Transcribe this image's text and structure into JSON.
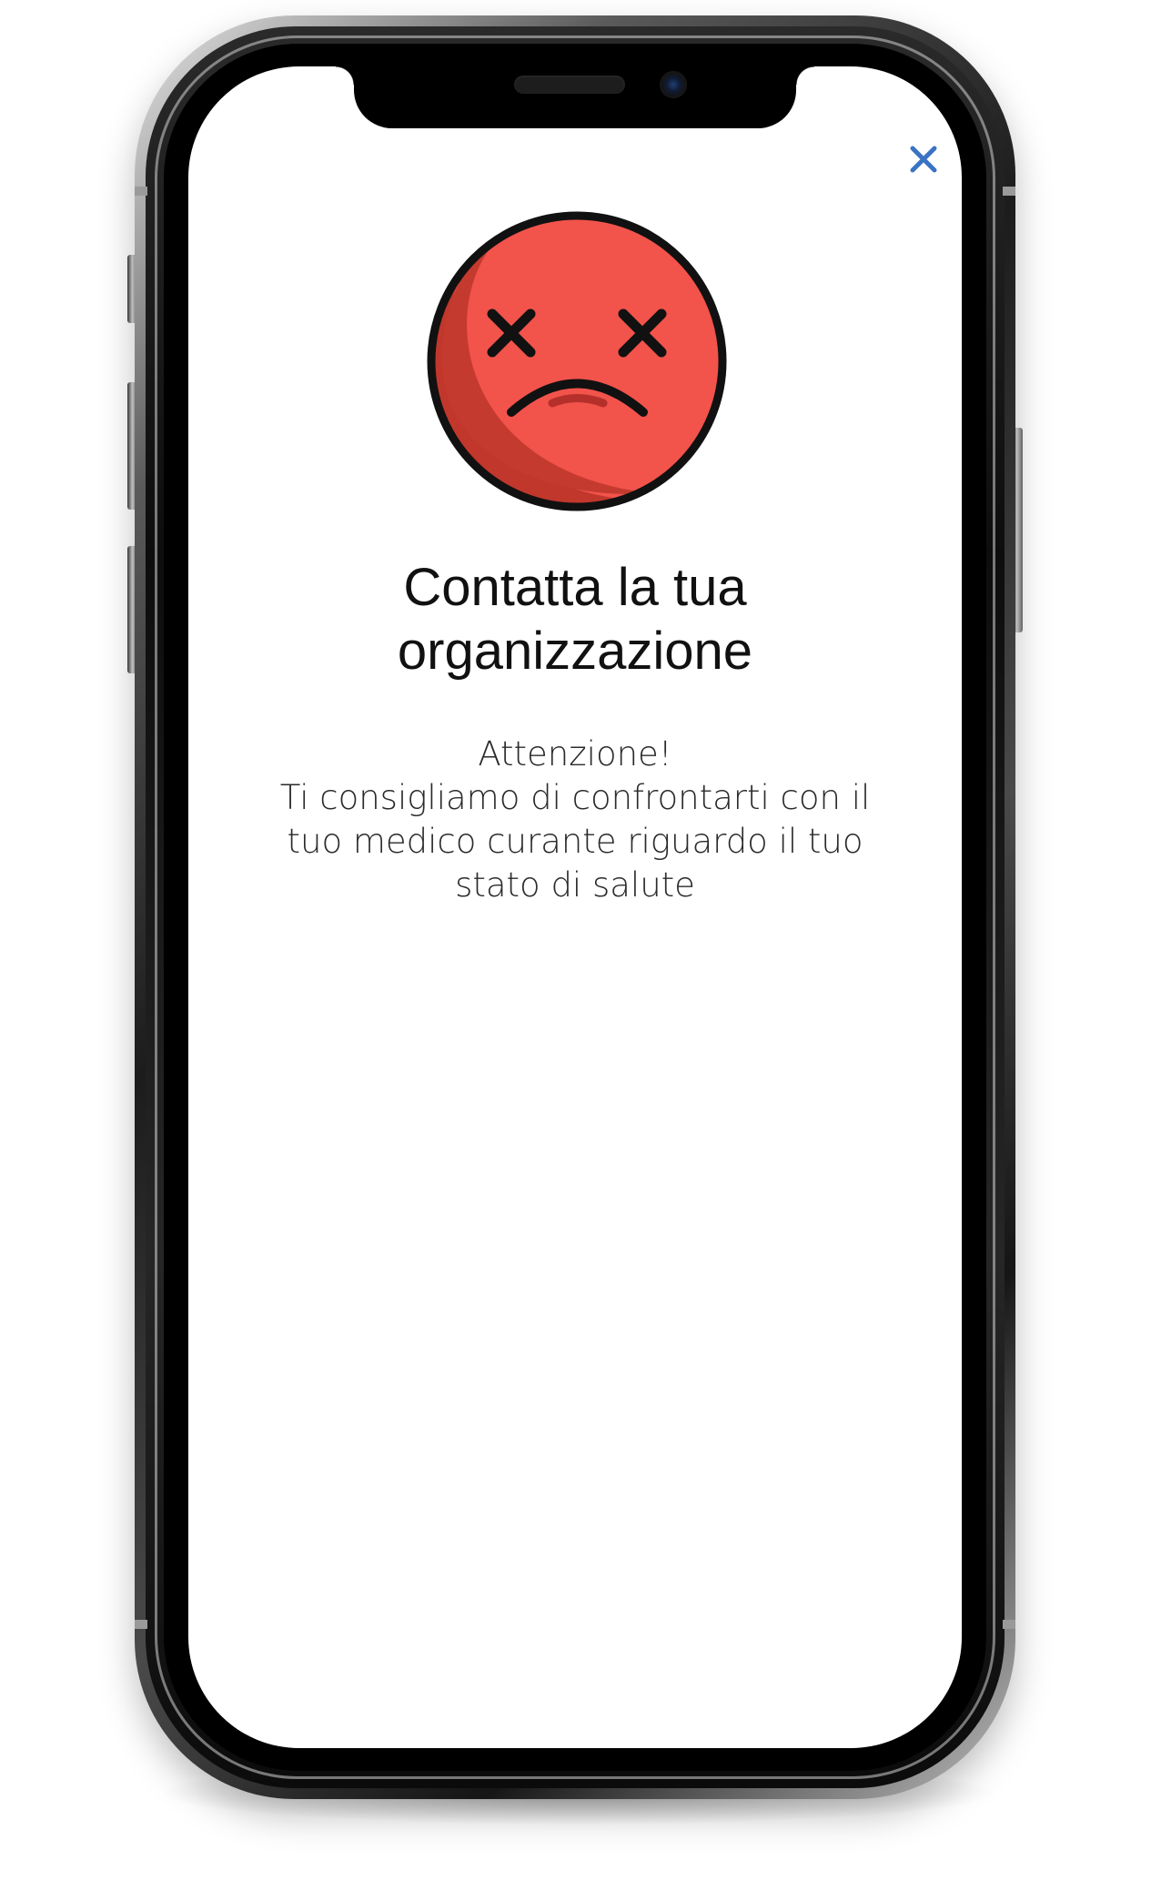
{
  "dialog": {
    "title_line1": "Contatta la tua",
    "title_line2": "organizzazione",
    "message_line1": "Attenzione!",
    "message_line2": "Ti consigliamo di confrontarti con il",
    "message_line3": "tuo medico curante riguardo il tuo",
    "message_line4": "stato di salute"
  },
  "icons": {
    "close": "close-icon",
    "status": "sad-face-dizzy-eyes-icon"
  },
  "colors": {
    "close_icon": "#3b73c4",
    "face_fill": "#f2534b",
    "face_shade": "#b83227",
    "face_outline": "#111111",
    "mouth_inner": "#b5302a",
    "screen_background": "#ffffff",
    "text": "#111111"
  }
}
